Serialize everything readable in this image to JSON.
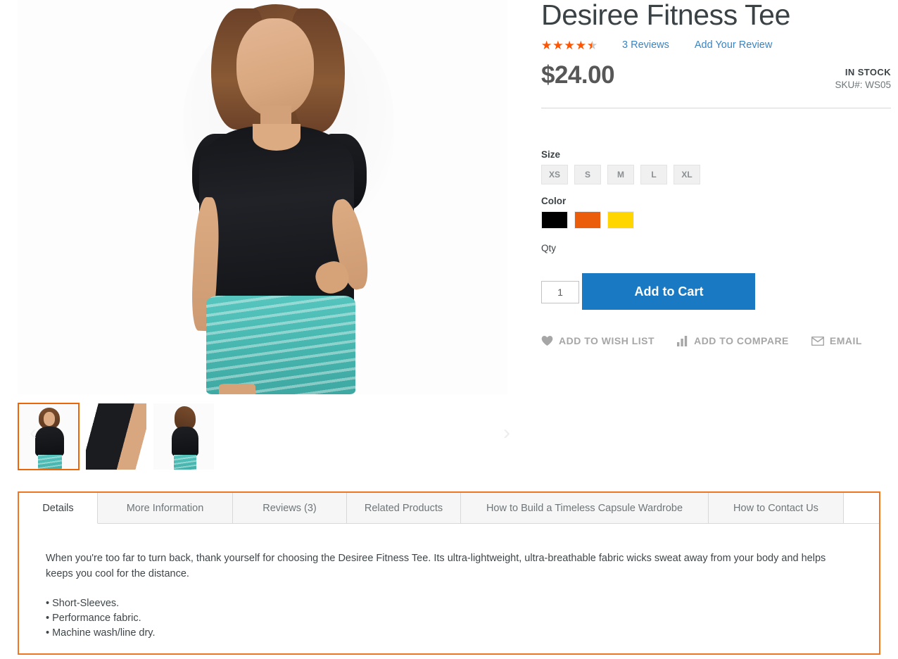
{
  "product": {
    "title": "Desiree Fitness Tee",
    "rating_percent": 86,
    "stars_glyphs": "★★★★★",
    "reviews_link": "3 Reviews",
    "add_review_link": "Add Your Review",
    "price": "$24.00",
    "stock_status": "IN STOCK",
    "sku": "SKU#:  WS05"
  },
  "options": {
    "size_label": "Size",
    "sizes": [
      "XS",
      "S",
      "M",
      "L",
      "XL"
    ],
    "color_label": "Color",
    "colors": [
      {
        "name": "black",
        "hex": "#000000"
      },
      {
        "name": "orange",
        "hex": "#eb5d0b"
      },
      {
        "name": "yellow",
        "hex": "#ffd600"
      }
    ],
    "qty_label": "Qty",
    "qty_value": "1",
    "add_to_cart_label": "Add to Cart"
  },
  "actions": [
    {
      "icon": "heart-icon",
      "label": "ADD TO WISH LIST"
    },
    {
      "icon": "bar-chart-icon",
      "label": "ADD TO COMPARE"
    },
    {
      "icon": "envelope-icon",
      "label": "EMAIL"
    }
  ],
  "gallery": {
    "prev_icon": "chevron-left-icon",
    "next_icon": "chevron-right-icon",
    "thumbs": [
      {
        "name": "thumbnail-front",
        "selected": true
      },
      {
        "name": "thumbnail-sleeve-detail",
        "selected": false
      },
      {
        "name": "thumbnail-back",
        "selected": false
      }
    ]
  },
  "tabs": [
    {
      "label": "Details",
      "active": true
    },
    {
      "label": "More Information",
      "active": false
    },
    {
      "label": "Reviews (3)",
      "active": false
    },
    {
      "label": "Related Products",
      "active": false
    },
    {
      "label": "How to Build a Timeless Capsule Wardrobe",
      "active": false
    },
    {
      "label": "How to Contact Us",
      "active": false
    }
  ],
  "details": {
    "description": "When you're too far to turn back, thank yourself for choosing the Desiree Fitness Tee. Its ultra-lightweight, ultra-breathable fabric wicks sweat away from your body and helps keeps you cool for the distance.",
    "bullets": [
      "• Short-Sleeves.",
      "• Performance fabric.",
      "• Machine wash/line dry."
    ]
  },
  "colors": {
    "accent_orange": "#ef7622",
    "link_blue": "#3a84c3",
    "button_blue": "#1979c3",
    "star_orange": "#ff5501"
  }
}
